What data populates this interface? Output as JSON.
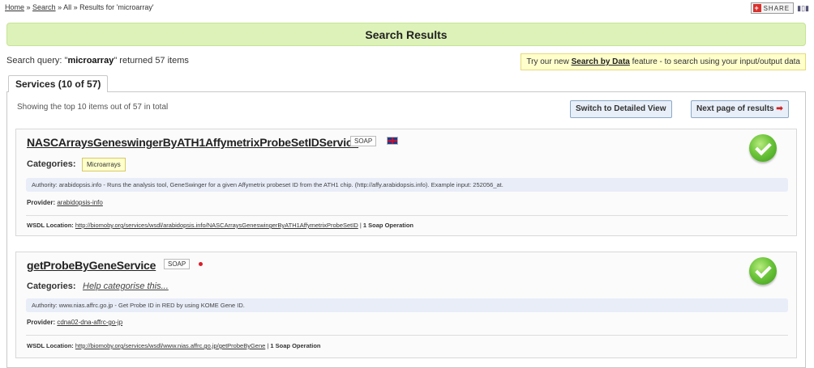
{
  "breadcrumb": {
    "home": "Home",
    "sep1": " » ",
    "search": "Search",
    "sep2": " » ",
    "all": "All",
    "sep3": " » ",
    "results": "Results for 'microarray'"
  },
  "share": {
    "label": "SHARE"
  },
  "page": {
    "title": "Search Results"
  },
  "query": {
    "prefix": "Search query: \"",
    "term": "microarray",
    "suffix": "\" returned 57 items"
  },
  "tip": {
    "prefix": "Try our new ",
    "link": "Search by Data",
    "suffix": " feature - to search using your input/output data"
  },
  "tab": {
    "label": "Services (10 of 57)"
  },
  "panel": {
    "showing": "Showing the top 10 items out of 57 in total",
    "switch_label": "Switch to Detailed View",
    "next_label": "Next page of results",
    "next_arrow": "➡"
  },
  "results": [
    {
      "title": "NASCArraysGeneswingerByATH1AffymetrixProbeSetIDService",
      "badge": "SOAP",
      "flag": "uk-flag-icon",
      "categories_label": "Categories:",
      "category": "Microarrays",
      "authority": "Authority: arabidopsis.info - Runs the analysis tool, GeneSwinger for a given Affymetrix probeset ID from the ATH1 chip. (http://affy.arabidopsis.info). Example input: 252056_at.",
      "provider_label": "Provider:",
      "provider": "arabidopsis-info",
      "wsdl_label": "WSDL Location:",
      "wsdl_url": "http://biomoby.org/services/wsdl/arabidopsis.info/NASCArraysGeneswingerByATH1AffymetrixProbeSetID",
      "wsdl_sep": " | ",
      "ops": "1 Soap Operation"
    },
    {
      "title": "getProbeByGeneService",
      "badge": "SOAP",
      "flag": "jp-flag-icon",
      "categories_label": "Categories:",
      "category_help": "Help categorise this...",
      "authority": "Authority: www.nias.affrc.go.jp - Get Probe ID in RED by using KOME Gene ID.",
      "provider_label": "Provider:",
      "provider": "cdna02-dna-affrc-go-jp",
      "wsdl_label": "WSDL Location:",
      "wsdl_url": "http://biomoby.org/services/wsdl/www.nias.affrc.go.jp/getProbeByGene",
      "wsdl_sep": " | ",
      "ops": "1 Soap Operation"
    }
  ],
  "colors": {
    "title_bar": "#ddf2b8",
    "tip_bg": "#ffffcc",
    "authority_bg": "#e8edf8",
    "status_green": "#6cc53a"
  }
}
